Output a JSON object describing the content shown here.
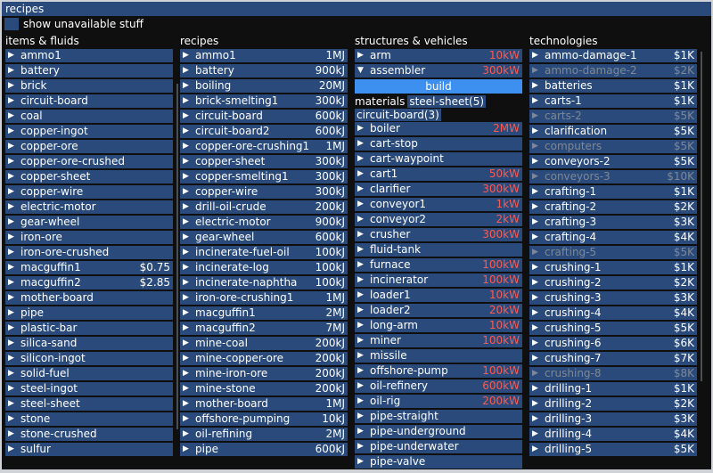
{
  "window": {
    "title": "recipes"
  },
  "toolbar": {
    "checkbox_label": "show unavailable stuff"
  },
  "columns": {
    "items": {
      "header": "items & fluids",
      "rows": [
        {
          "name": "ammo1",
          "value": ""
        },
        {
          "name": "battery",
          "value": ""
        },
        {
          "name": "brick",
          "value": ""
        },
        {
          "name": "circuit-board",
          "value": ""
        },
        {
          "name": "coal",
          "value": ""
        },
        {
          "name": "copper-ingot",
          "value": ""
        },
        {
          "name": "copper-ore",
          "value": ""
        },
        {
          "name": "copper-ore-crushed",
          "value": ""
        },
        {
          "name": "copper-sheet",
          "value": ""
        },
        {
          "name": "copper-wire",
          "value": ""
        },
        {
          "name": "electric-motor",
          "value": ""
        },
        {
          "name": "gear-wheel",
          "value": ""
        },
        {
          "name": "iron-ore",
          "value": ""
        },
        {
          "name": "iron-ore-crushed",
          "value": ""
        },
        {
          "name": "macguffin1",
          "value": "$0.75"
        },
        {
          "name": "macguffin2",
          "value": "$2.85"
        },
        {
          "name": "mother-board",
          "value": ""
        },
        {
          "name": "pipe",
          "value": ""
        },
        {
          "name": "plastic-bar",
          "value": ""
        },
        {
          "name": "silica-sand",
          "value": ""
        },
        {
          "name": "silicon-ingot",
          "value": ""
        },
        {
          "name": "solid-fuel",
          "value": ""
        },
        {
          "name": "steel-ingot",
          "value": ""
        },
        {
          "name": "steel-sheet",
          "value": ""
        },
        {
          "name": "stone",
          "value": ""
        },
        {
          "name": "stone-crushed",
          "value": ""
        },
        {
          "name": "sulfur",
          "value": ""
        }
      ]
    },
    "recipes": {
      "header": "recipes",
      "rows": [
        {
          "name": "ammo1",
          "value": "1MJ"
        },
        {
          "name": "battery",
          "value": "900kJ"
        },
        {
          "name": "boiling",
          "value": "20MJ"
        },
        {
          "name": "brick-smelting1",
          "value": "300kJ"
        },
        {
          "name": "circuit-board",
          "value": "600kJ"
        },
        {
          "name": "circuit-board2",
          "value": "600kJ"
        },
        {
          "name": "copper-ore-crushing1",
          "value": "1MJ"
        },
        {
          "name": "copper-sheet",
          "value": "300kJ"
        },
        {
          "name": "copper-smelting1",
          "value": "300kJ"
        },
        {
          "name": "copper-wire",
          "value": "300kJ"
        },
        {
          "name": "drill-oil-crude",
          "value": "200kJ"
        },
        {
          "name": "electric-motor",
          "value": "900kJ"
        },
        {
          "name": "gear-wheel",
          "value": "600kJ"
        },
        {
          "name": "incinerate-fuel-oil",
          "value": "100kJ"
        },
        {
          "name": "incinerate-log",
          "value": "100kJ"
        },
        {
          "name": "incinerate-naphtha",
          "value": "100kJ"
        },
        {
          "name": "iron-ore-crushing1",
          "value": "1MJ"
        },
        {
          "name": "macguffin1",
          "value": "2MJ"
        },
        {
          "name": "macguffin2",
          "value": "7MJ"
        },
        {
          "name": "mine-coal",
          "value": "200kJ"
        },
        {
          "name": "mine-copper-ore",
          "value": "200kJ"
        },
        {
          "name": "mine-iron-ore",
          "value": "200kJ"
        },
        {
          "name": "mine-stone",
          "value": "200kJ"
        },
        {
          "name": "mother-board",
          "value": "1MJ"
        },
        {
          "name": "offshore-pumping",
          "value": "10kJ"
        },
        {
          "name": "oil-refining",
          "value": "2MJ"
        },
        {
          "name": "pipe",
          "value": "600kJ"
        }
      ]
    },
    "structures": {
      "header": "structures & vehicles",
      "before": [
        {
          "name": "arm",
          "value": "10kW",
          "expanded": false
        },
        {
          "name": "assembler",
          "value": "300kW",
          "expanded": true
        }
      ],
      "build_label": "build",
      "materials_label": "materials",
      "materials": [
        "steel-sheet(5)",
        "circuit-board(3)"
      ],
      "after": [
        {
          "name": "boiler",
          "value": "2MW"
        },
        {
          "name": "cart-stop",
          "value": ""
        },
        {
          "name": "cart-waypoint",
          "value": ""
        },
        {
          "name": "cart1",
          "value": "50kW"
        },
        {
          "name": "clarifier",
          "value": "300kW"
        },
        {
          "name": "conveyor1",
          "value": "1kW"
        },
        {
          "name": "conveyor2",
          "value": "2kW"
        },
        {
          "name": "crusher",
          "value": "300kW"
        },
        {
          "name": "fluid-tank",
          "value": ""
        },
        {
          "name": "furnace",
          "value": "100kW"
        },
        {
          "name": "incinerator",
          "value": "100kW"
        },
        {
          "name": "loader1",
          "value": "10kW"
        },
        {
          "name": "loader2",
          "value": "20kW"
        },
        {
          "name": "long-arm",
          "value": "10kW"
        },
        {
          "name": "miner",
          "value": "100kW"
        },
        {
          "name": "missile",
          "value": ""
        },
        {
          "name": "offshore-pump",
          "value": "100kW"
        },
        {
          "name": "oil-refinery",
          "value": "600kW"
        },
        {
          "name": "oil-rig",
          "value": "200kW"
        },
        {
          "name": "pipe-straight",
          "value": ""
        },
        {
          "name": "pipe-underground",
          "value": ""
        },
        {
          "name": "pipe-underwater",
          "value": ""
        },
        {
          "name": "pipe-valve",
          "value": ""
        }
      ]
    },
    "technologies": {
      "header": "technologies",
      "rows": [
        {
          "name": "ammo-damage-1",
          "value": "$1K",
          "unavailable": false
        },
        {
          "name": "ammo-damage-2",
          "value": "$2K",
          "unavailable": true
        },
        {
          "name": "batteries",
          "value": "$1K",
          "unavailable": false
        },
        {
          "name": "carts-1",
          "value": "$1K",
          "unavailable": false
        },
        {
          "name": "carts-2",
          "value": "$5K",
          "unavailable": true
        },
        {
          "name": "clarification",
          "value": "$5K",
          "unavailable": false
        },
        {
          "name": "computers",
          "value": "$5K",
          "unavailable": true
        },
        {
          "name": "conveyors-2",
          "value": "$5K",
          "unavailable": false
        },
        {
          "name": "conveyors-3",
          "value": "$10K",
          "unavailable": true
        },
        {
          "name": "crafting-1",
          "value": "$1K",
          "unavailable": false
        },
        {
          "name": "crafting-2",
          "value": "$2K",
          "unavailable": false
        },
        {
          "name": "crafting-3",
          "value": "$3K",
          "unavailable": false
        },
        {
          "name": "crafting-4",
          "value": "$4K",
          "unavailable": false
        },
        {
          "name": "crafting-5",
          "value": "$5K",
          "unavailable": true
        },
        {
          "name": "crushing-1",
          "value": "$1K",
          "unavailable": false
        },
        {
          "name": "crushing-2",
          "value": "$2K",
          "unavailable": false
        },
        {
          "name": "crushing-3",
          "value": "$3K",
          "unavailable": false
        },
        {
          "name": "crushing-4",
          "value": "$4K",
          "unavailable": false
        },
        {
          "name": "crushing-5",
          "value": "$5K",
          "unavailable": false
        },
        {
          "name": "crushing-6",
          "value": "$6K",
          "unavailable": false
        },
        {
          "name": "crushing-7",
          "value": "$7K",
          "unavailable": false
        },
        {
          "name": "crushing-8",
          "value": "$8K",
          "unavailable": true
        },
        {
          "name": "drilling-1",
          "value": "$1K",
          "unavailable": false
        },
        {
          "name": "drilling-2",
          "value": "$2K",
          "unavailable": false
        },
        {
          "name": "drilling-3",
          "value": "$3K",
          "unavailable": false
        },
        {
          "name": "drilling-4",
          "value": "$4K",
          "unavailable": false
        },
        {
          "name": "drilling-5",
          "value": "$5K",
          "unavailable": false
        }
      ]
    }
  },
  "colors": {
    "row_bg": "#294a7a",
    "build_button": "#3d8ff0",
    "power_value": "#ff5a4f",
    "disabled_text": "#7f8894"
  }
}
